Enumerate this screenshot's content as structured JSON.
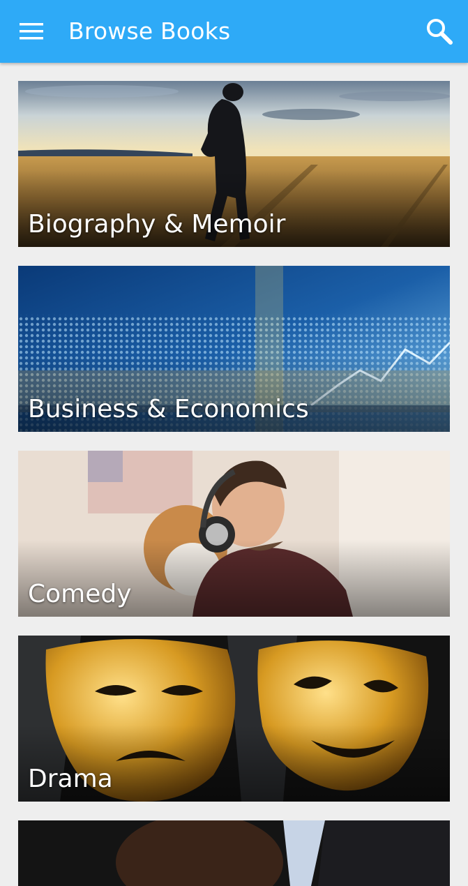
{
  "app_bar": {
    "title": "Browse Books",
    "menu_icon": "hamburger-menu-icon",
    "search_icon": "search-icon",
    "color": "#2eaaf7"
  },
  "categories": [
    {
      "label": "Biography & Memoir"
    },
    {
      "label": "Business & Economics"
    },
    {
      "label": "Comedy"
    },
    {
      "label": "Drama"
    }
  ]
}
